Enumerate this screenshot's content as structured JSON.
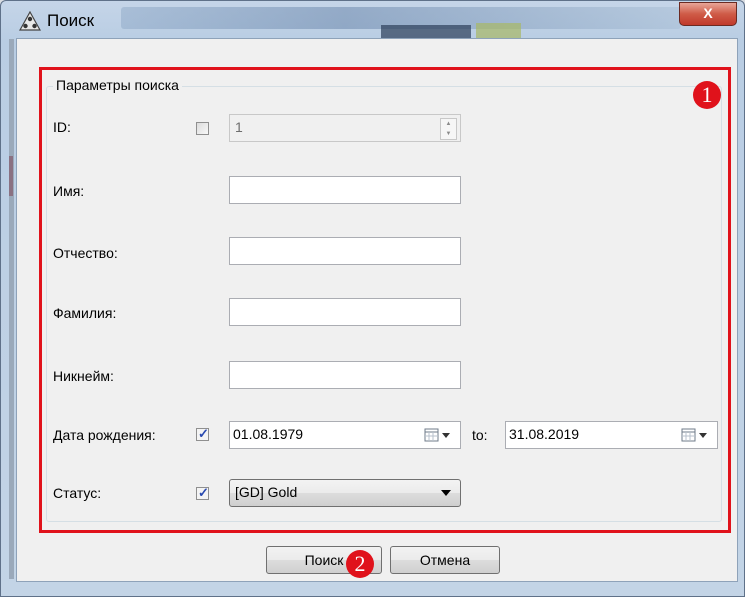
{
  "window": {
    "title": "Поиск",
    "close_label": "X"
  },
  "group": {
    "legend": "Параметры поиска"
  },
  "fields": {
    "id": {
      "label": "ID:",
      "checked": false,
      "value": "1"
    },
    "first_name": {
      "label": "Имя:",
      "value": ""
    },
    "patronymic": {
      "label": "Отчество:",
      "value": ""
    },
    "last_name": {
      "label": "Фамилия:",
      "value": ""
    },
    "nickname": {
      "label": "Никнейм:",
      "value": ""
    },
    "birth_date": {
      "label": "Дата рождения:",
      "checked": true,
      "from": "01.08.1979",
      "to_label": "to:",
      "to": "31.08.2019"
    },
    "status": {
      "label": "Статус:",
      "checked": true,
      "selected": "[GD] Gold"
    }
  },
  "buttons": {
    "search": "Поиск",
    "cancel": "Отмена"
  },
  "annotations": {
    "badge1": "1",
    "badge2": "2",
    "color": "#e0121b"
  }
}
